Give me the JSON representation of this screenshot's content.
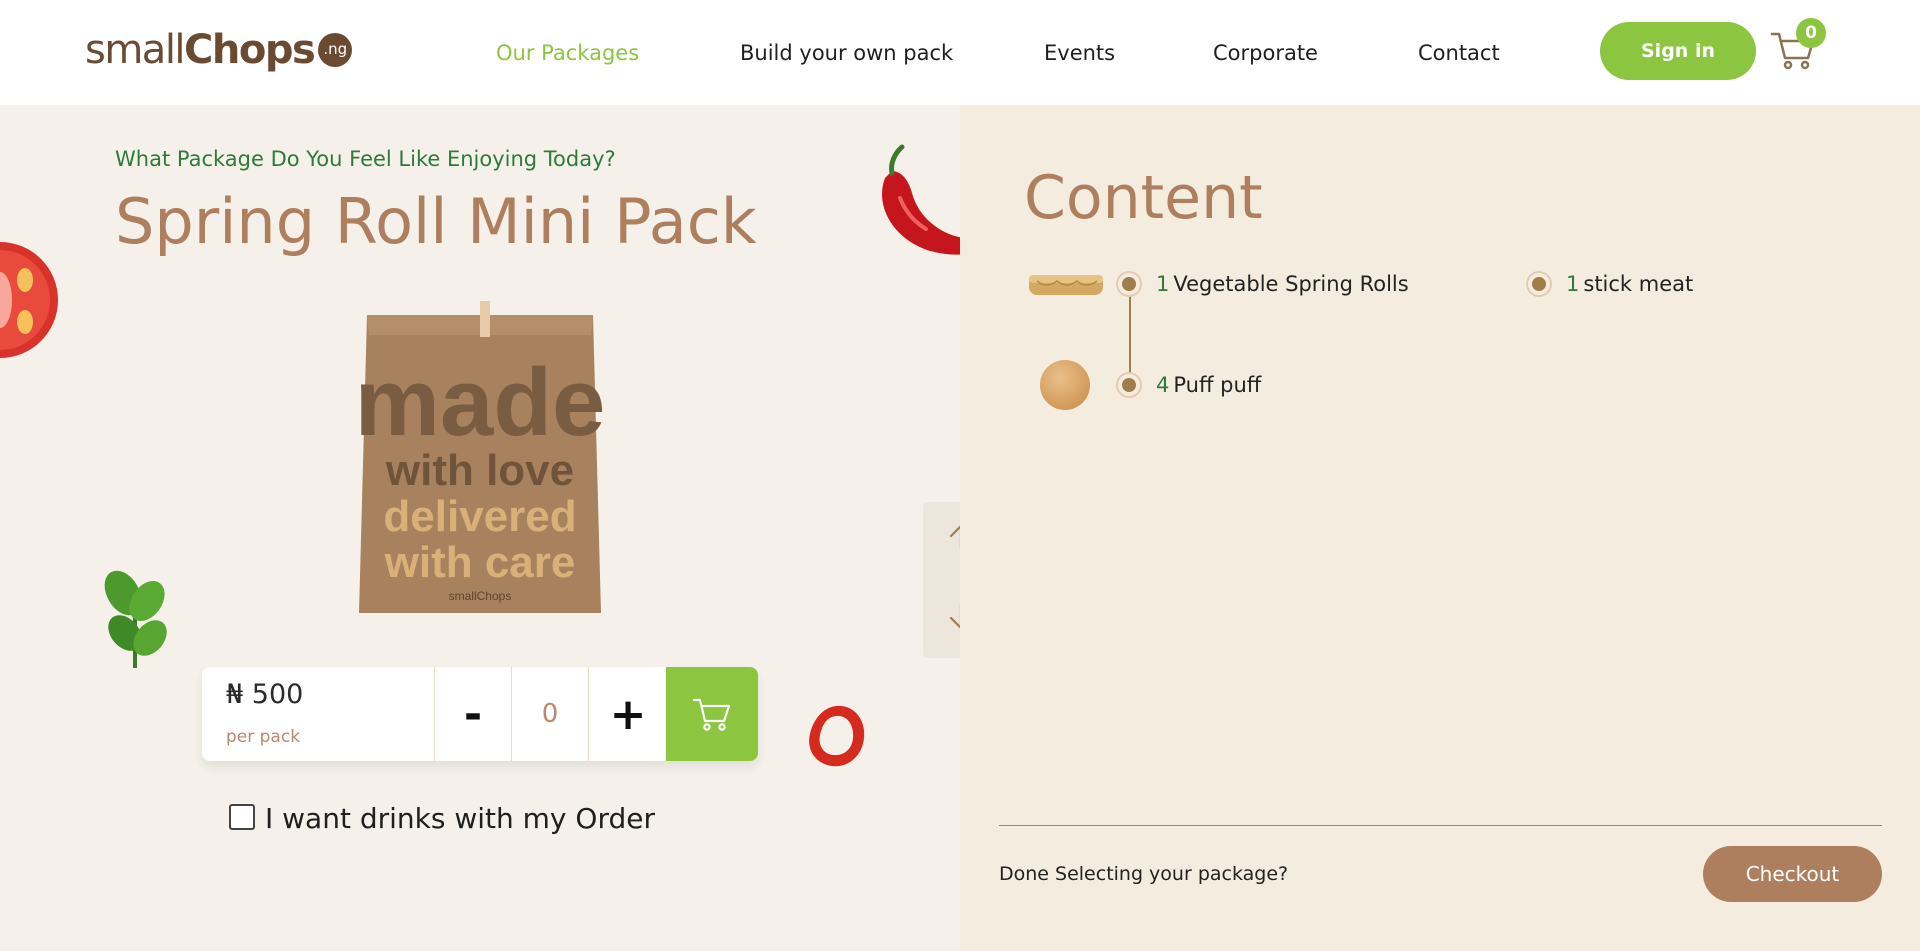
{
  "brand": {
    "name_light": "small",
    "name_bold": "Chops",
    "badge": ".ng"
  },
  "nav": {
    "items": [
      {
        "label": "Our Packages",
        "active": true
      },
      {
        "label": "Build your own pack",
        "active": false
      },
      {
        "label": "Events",
        "active": false
      },
      {
        "label": "Corporate",
        "active": false
      },
      {
        "label": "Contact",
        "active": false
      }
    ],
    "signin_label": "Sign in",
    "cart_count": "0"
  },
  "colors": {
    "accent_green": "#8cc540",
    "brand_brown": "#ad7f5f",
    "dark_brown": "#6b4a32",
    "subtitle_green": "#2f7a3a"
  },
  "package": {
    "subtitle": "What Package Do You Feel Like Enjoying Today?",
    "title": "Spring Roll Mini Pack",
    "bag_text": [
      "made",
      "with love",
      "delivered",
      "with care"
    ],
    "bag_brand": "smallChops",
    "price": "₦ 500",
    "price_unit": "per pack",
    "quantity": "0",
    "minus_label": "-",
    "plus_label": "+",
    "drinks_label": "I want drinks with my Order"
  },
  "content": {
    "title": "Content",
    "items": [
      {
        "qty": "1",
        "name": "Vegetable Spring Rolls"
      },
      {
        "qty": "1",
        "name": "stick meat"
      },
      {
        "qty": "4",
        "name": "Puff puff"
      }
    ],
    "done_text": "Done Selecting your package?",
    "checkout_label": "Checkout"
  },
  "icons": {
    "cart": "cart-icon",
    "arrow_up": "arrow-up-icon",
    "arrow_down": "arrow-down-icon"
  }
}
